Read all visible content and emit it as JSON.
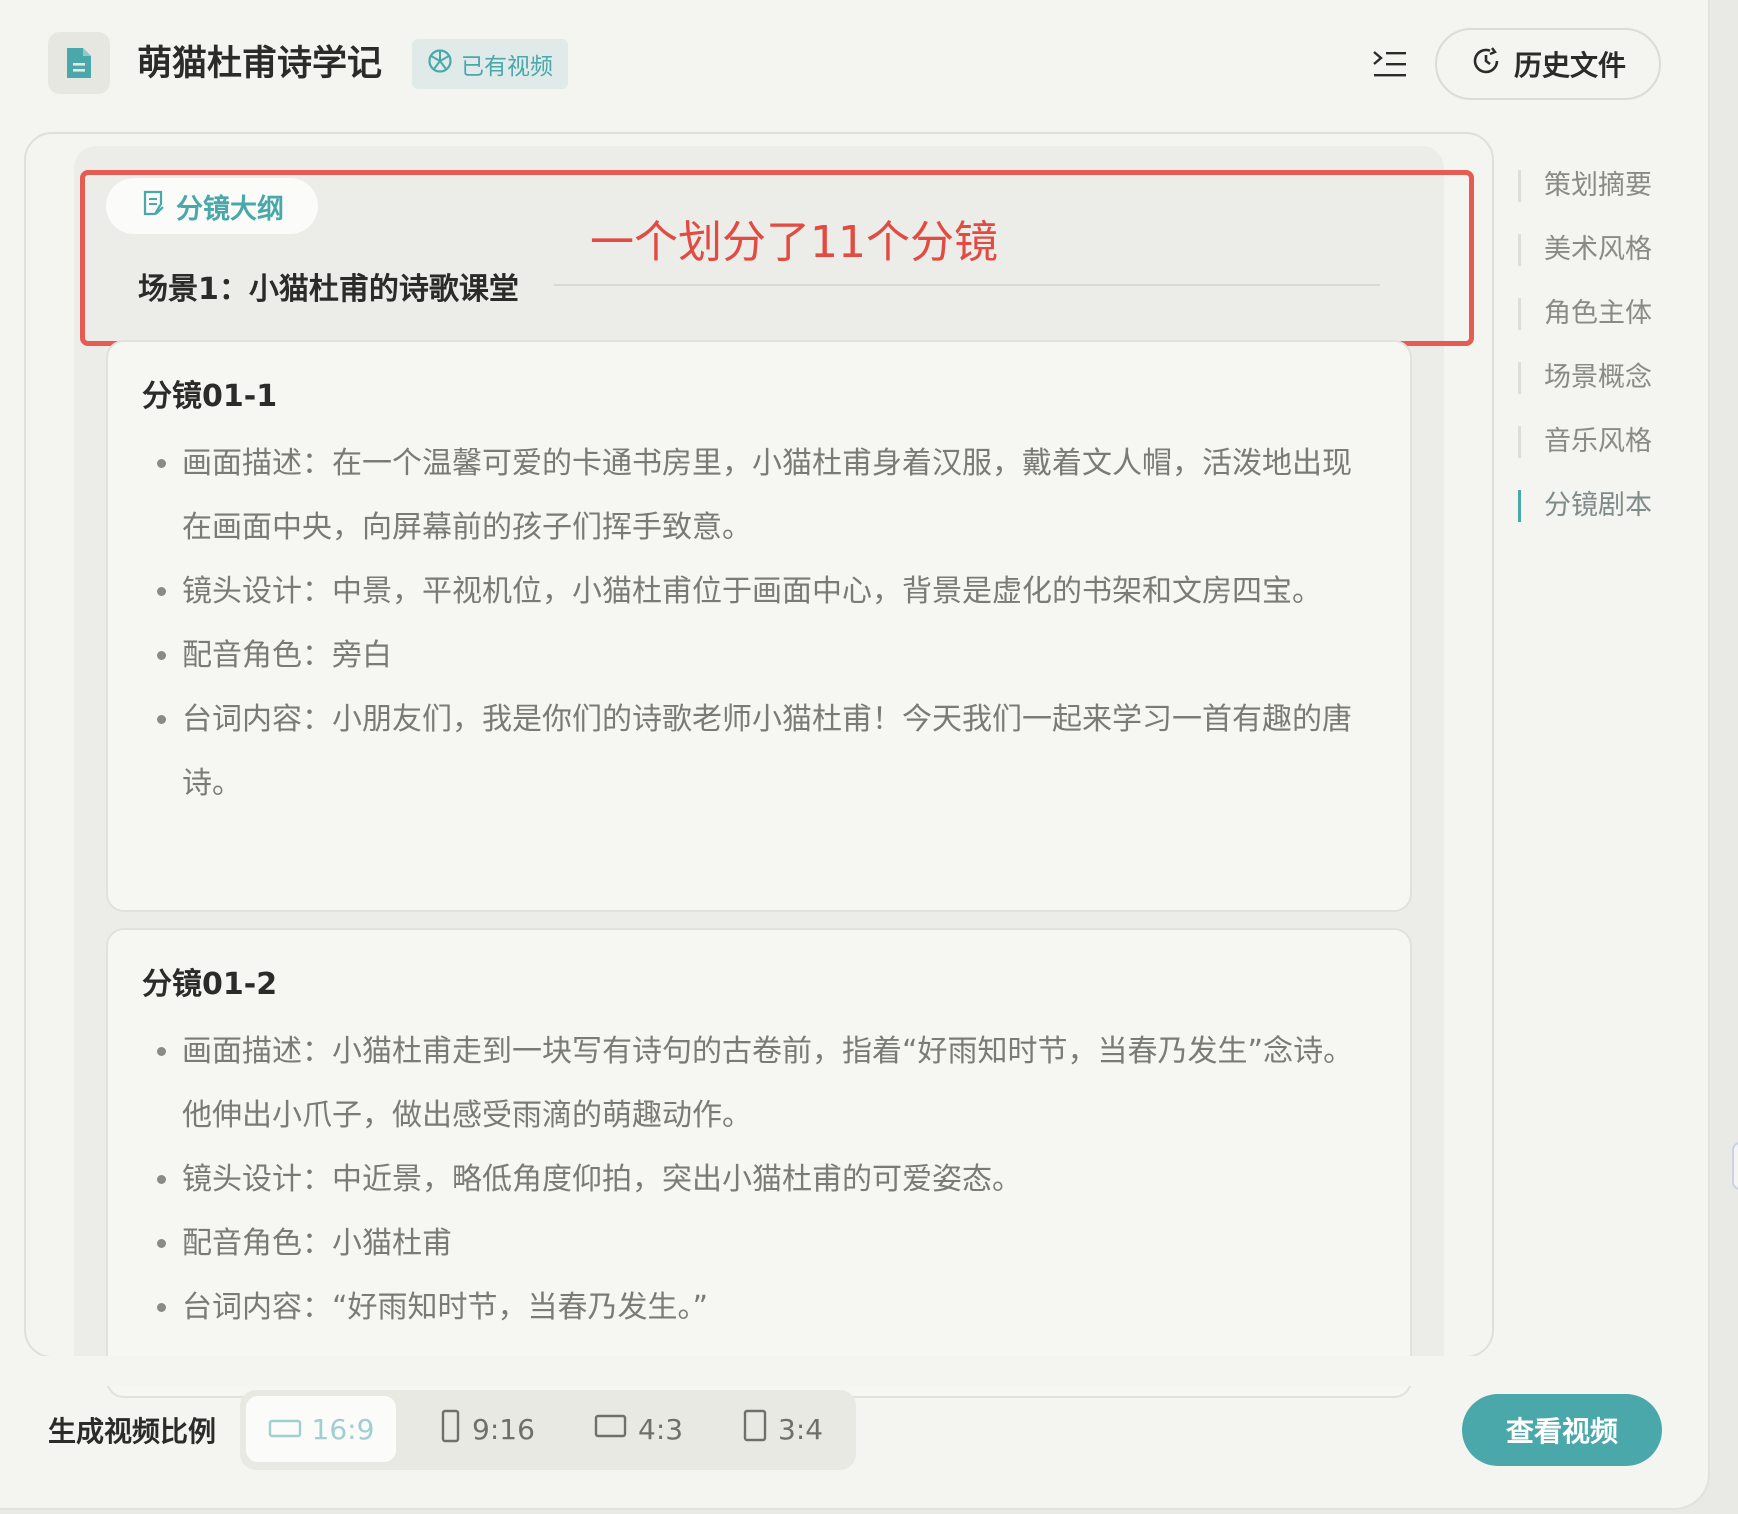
{
  "header": {
    "title": "萌猫杜甫诗学记",
    "badge": "已有视频",
    "history_button": "历史文件"
  },
  "outline": {
    "chip_label": "分镜大纲",
    "scene_title": "场景1：小猫杜甫的诗歌课堂",
    "annotation": "一个划分了11个分镜"
  },
  "shots": [
    {
      "title": "分镜01-1",
      "items": [
        "画面描述：在一个温馨可爱的卡通书房里，小猫杜甫身着汉服，戴着文人帽，活泼地出现在画面中央，向屏幕前的孩子们挥手致意。",
        "镜头设计：中景，平视机位，小猫杜甫位于画面中心，背景是虚化的书架和文房四宝。",
        "配音角色：旁白",
        "台词内容：小朋友们，我是你们的诗歌老师小猫杜甫！今天我们一起来学习一首有趣的唐诗。"
      ]
    },
    {
      "title": "分镜01-2",
      "items": [
        "画面描述：小猫杜甫走到一块写有诗句的古卷前，指着“好雨知时节，当春乃发生”念诗。他伸出小爪子，做出感受雨滴的萌趣动作。",
        "镜头设计：中近景，略低角度仰拍，突出小猫杜甫的可爱姿态。",
        "配音角色：小猫杜甫",
        "台词内容：“好雨知时节，当春乃发生。”"
      ]
    }
  ],
  "toc": {
    "items": [
      "策划摘要",
      "美术风格",
      "角色主体",
      "场景概念",
      "音乐风格",
      "分镜剧本"
    ],
    "active_index": 5
  },
  "footer": {
    "ratio_label": "生成视频比例",
    "ratios": [
      "16:9",
      "9:16",
      "4:3",
      "3:4"
    ],
    "selected_ratio": "16:9",
    "view_button": "查看视频"
  },
  "colors": {
    "accent": "#4aa8aa",
    "annotation": "#e55c53",
    "background": "#f4f4f0"
  },
  "icons": {
    "doc": "document-icon",
    "badge": "video-icon",
    "outline_toggle": "outline-toggle-icon",
    "history": "history-clock-icon",
    "chip": "outline-doc-icon"
  }
}
